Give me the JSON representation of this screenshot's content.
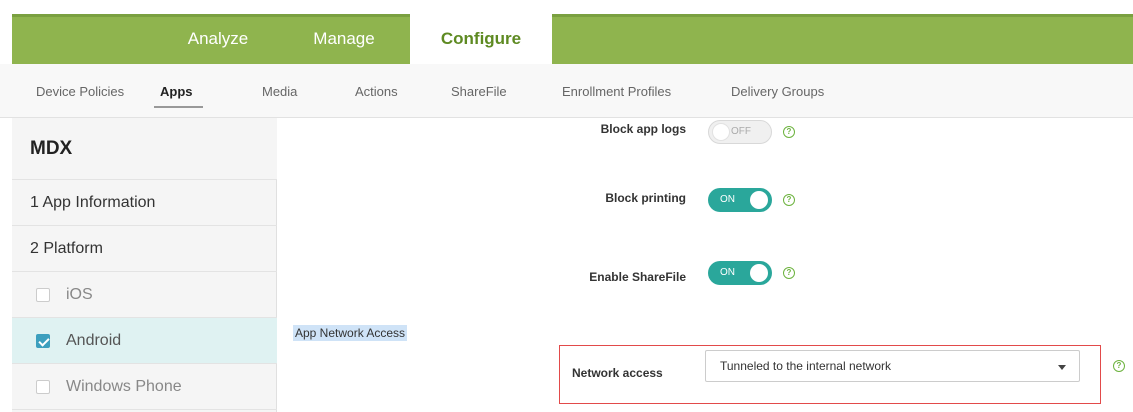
{
  "topnav": {
    "tabs": [
      {
        "label": "Analyze"
      },
      {
        "label": "Manage"
      },
      {
        "label": "Configure"
      }
    ]
  },
  "subnav": {
    "tabs": [
      {
        "label": "Device Policies"
      },
      {
        "label": "Apps"
      },
      {
        "label": "Media"
      },
      {
        "label": "Actions"
      },
      {
        "label": "ShareFile"
      },
      {
        "label": "Enrollment Profiles"
      },
      {
        "label": "Delivery Groups"
      }
    ]
  },
  "sidebar": {
    "title": "MDX",
    "items": [
      {
        "label": "1 App Information"
      },
      {
        "label": "2 Platform"
      },
      {
        "label": "iOS",
        "checked": false
      },
      {
        "label": "Android",
        "checked": true
      },
      {
        "label": "Windows Phone",
        "checked": false
      }
    ]
  },
  "content": {
    "block_app_logs": {
      "label": "Block app logs",
      "state": "OFF"
    },
    "block_printing": {
      "label": "Block printing",
      "state": "ON"
    },
    "enable_sharefile": {
      "label": "Enable ShareFile",
      "state": "ON"
    },
    "section_label": "App Network Access",
    "network_access": {
      "label": "Network access",
      "value": "Tunneled to the internal network"
    },
    "help_glyph": "?"
  },
  "colors": {
    "nav_green": "#8fb44e",
    "toggle_on": "#2aa79b",
    "highlight_red": "#e24a4a",
    "selection_bg": "#dff2f2"
  }
}
